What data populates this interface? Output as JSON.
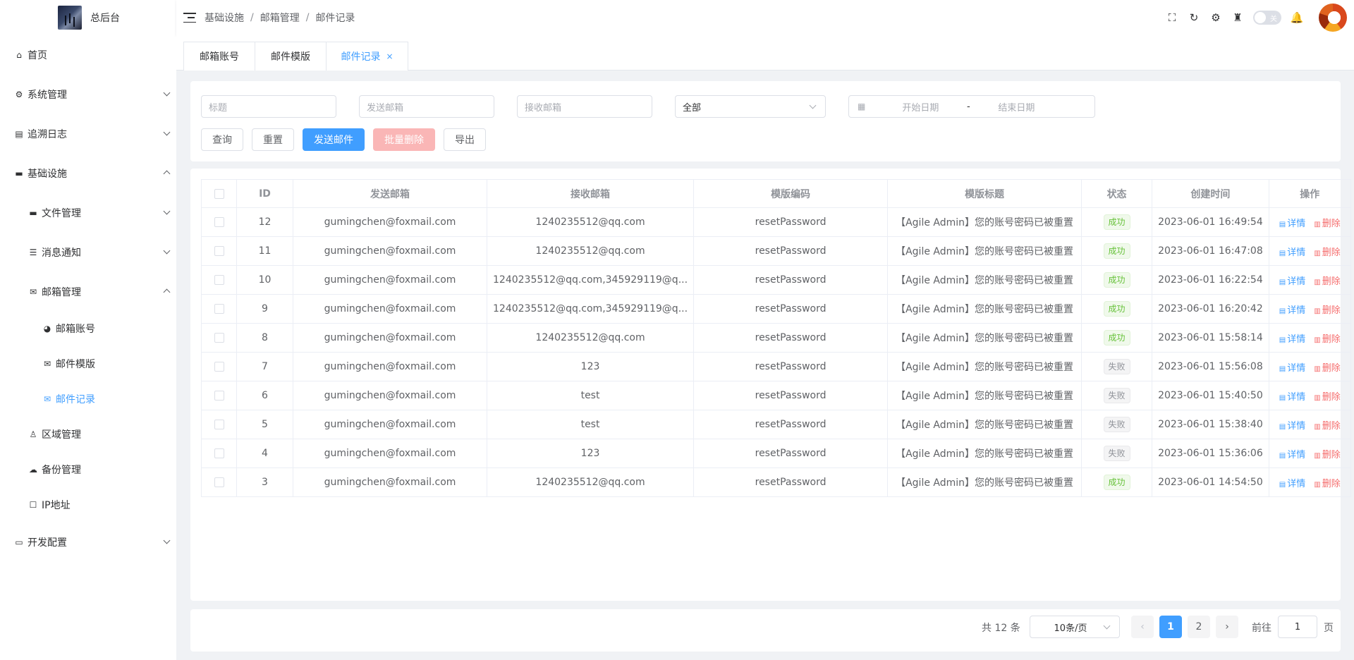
{
  "app": {
    "title": "总后台"
  },
  "sidebar": {
    "items": [
      {
        "label": "首页",
        "icon": "home-icon"
      },
      {
        "label": "系统管理",
        "icon": "gear-icon"
      },
      {
        "label": "追溯日志",
        "icon": "log-icon"
      },
      {
        "label": "基础设施",
        "icon": "folder-icon"
      },
      {
        "label": "文件管理",
        "icon": "folder-icon"
      },
      {
        "label": "消息通知",
        "icon": "database-icon"
      },
      {
        "label": "邮箱管理",
        "icon": "mail-icon"
      },
      {
        "label": "邮箱账号",
        "icon": "dashboard-icon"
      },
      {
        "label": "邮件模版",
        "icon": "mail-icon"
      },
      {
        "label": "邮件记录",
        "icon": "mail-icon"
      },
      {
        "label": "区域管理",
        "icon": "user-location-icon"
      },
      {
        "label": "备份管理",
        "icon": "cloud-icon"
      },
      {
        "label": "IP地址",
        "icon": "square-icon"
      },
      {
        "label": "开发配置",
        "icon": "monitor-icon"
      }
    ]
  },
  "header": {
    "breadcrumb": [
      "基础设施",
      "邮箱管理",
      "邮件记录"
    ],
    "toggle_label": "关"
  },
  "tabs": [
    {
      "label": "邮箱账号"
    },
    {
      "label": "邮件模版"
    },
    {
      "label": "邮件记录",
      "close": "×"
    }
  ],
  "filters": {
    "title_placeholder": "标题",
    "from_placeholder": "发送邮箱",
    "to_placeholder": "接收邮箱",
    "status_value": "全部",
    "start_placeholder": "开始日期",
    "range_sep": "-",
    "end_placeholder": "结束日期"
  },
  "toolbar": {
    "query": "查询",
    "reset": "重置",
    "send": "发送邮件",
    "batch_delete": "批量删除",
    "export": "导出"
  },
  "table": {
    "headers": [
      "ID",
      "发送邮箱",
      "接收邮箱",
      "模版编码",
      "模版标题",
      "状态",
      "创建时间",
      "操作"
    ],
    "rows": [
      {
        "id": "12",
        "from": "gumingchen@foxmail.com",
        "to": "1240235512@qq.com",
        "code": "resetPassword",
        "title": "【Agile Admin】您的账号密码已被重置",
        "status": "成功",
        "ok": true,
        "time": "2023-06-01 16:49:54"
      },
      {
        "id": "11",
        "from": "gumingchen@foxmail.com",
        "to": "1240235512@qq.com",
        "code": "resetPassword",
        "title": "【Agile Admin】您的账号密码已被重置",
        "status": "成功",
        "ok": true,
        "time": "2023-06-01 16:47:08"
      },
      {
        "id": "10",
        "from": "gumingchen@foxmail.com",
        "to": "1240235512@qq.com,345929119@q...",
        "code": "resetPassword",
        "title": "【Agile Admin】您的账号密码已被重置",
        "status": "成功",
        "ok": true,
        "time": "2023-06-01 16:22:54"
      },
      {
        "id": "9",
        "from": "gumingchen@foxmail.com",
        "to": "1240235512@qq.com,345929119@q...",
        "code": "resetPassword",
        "title": "【Agile Admin】您的账号密码已被重置",
        "status": "成功",
        "ok": true,
        "time": "2023-06-01 16:20:42"
      },
      {
        "id": "8",
        "from": "gumingchen@foxmail.com",
        "to": "1240235512@qq.com",
        "code": "resetPassword",
        "title": "【Agile Admin】您的账号密码已被重置",
        "status": "成功",
        "ok": true,
        "time": "2023-06-01 15:58:14"
      },
      {
        "id": "7",
        "from": "gumingchen@foxmail.com",
        "to": "123",
        "code": "resetPassword",
        "title": "【Agile Admin】您的账号密码已被重置",
        "status": "失败",
        "ok": false,
        "time": "2023-06-01 15:56:08"
      },
      {
        "id": "6",
        "from": "gumingchen@foxmail.com",
        "to": "test",
        "code": "resetPassword",
        "title": "【Agile Admin】您的账号密码已被重置",
        "status": "失败",
        "ok": false,
        "time": "2023-06-01 15:40:50"
      },
      {
        "id": "5",
        "from": "gumingchen@foxmail.com",
        "to": "test",
        "code": "resetPassword",
        "title": "【Agile Admin】您的账号密码已被重置",
        "status": "失败",
        "ok": false,
        "time": "2023-06-01 15:38:40"
      },
      {
        "id": "4",
        "from": "gumingchen@foxmail.com",
        "to": "123",
        "code": "resetPassword",
        "title": "【Agile Admin】您的账号密码已被重置",
        "status": "失败",
        "ok": false,
        "time": "2023-06-01 15:36:06"
      },
      {
        "id": "3",
        "from": "gumingchen@foxmail.com",
        "to": "1240235512@qq.com",
        "code": "resetPassword",
        "title": "【Agile Admin】您的账号密码已被重置",
        "status": "成功",
        "ok": true,
        "time": "2023-06-01 14:54:50"
      }
    ],
    "actions": {
      "detail": "详情",
      "delete": "删除"
    }
  },
  "pagination": {
    "total": "共 12 条",
    "page_size": "10条/页",
    "pages": [
      "1",
      "2"
    ],
    "current": "1",
    "goto_prefix": "前往",
    "goto_value": "1",
    "goto_suffix": "页",
    "prev": "‹",
    "next": "›"
  }
}
